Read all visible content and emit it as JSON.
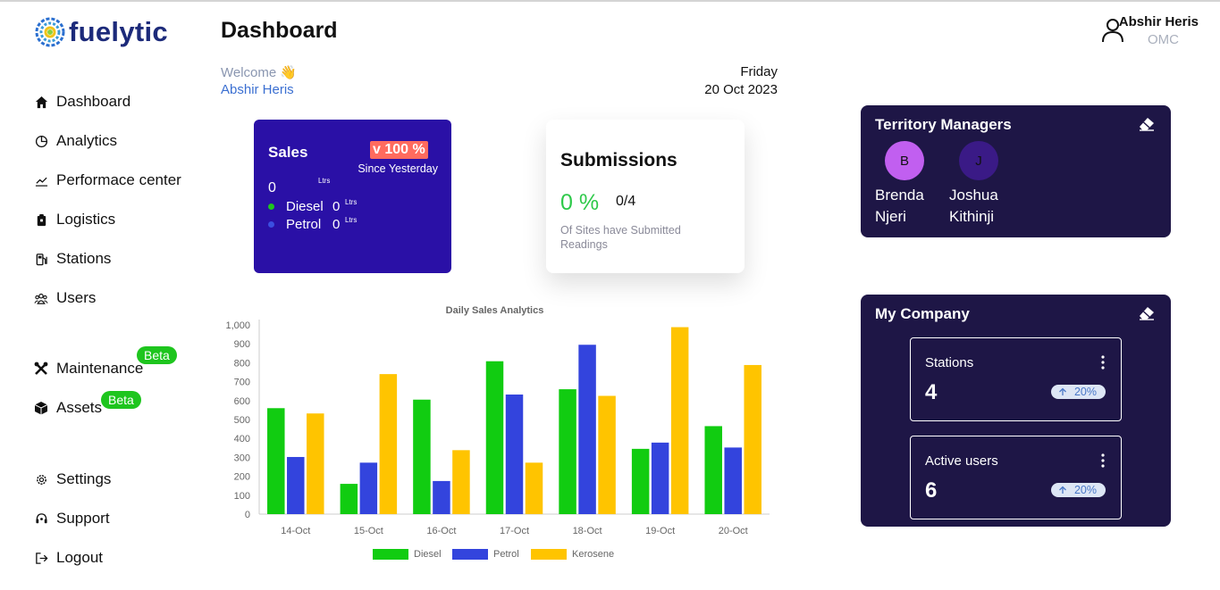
{
  "brand": {
    "name": "fuelytic"
  },
  "sidebar": {
    "items": [
      {
        "label": "Dashboard",
        "icon": "home-icon"
      },
      {
        "label": "Analytics",
        "icon": "pie-chart-icon"
      },
      {
        "label": "Performace center",
        "icon": "trend-line-icon"
      },
      {
        "label": "Logistics",
        "icon": "clipboard-icon"
      },
      {
        "label": "Stations",
        "icon": "fuel-pump-icon"
      },
      {
        "label": "Users",
        "icon": "users-icon"
      },
      {
        "label": "Maintenance",
        "icon": "tools-icon",
        "badge": "Beta"
      },
      {
        "label": "Assets",
        "icon": "box-icon",
        "badge": "Beta"
      },
      {
        "label": "Settings",
        "icon": "gear-icon"
      },
      {
        "label": "Support",
        "icon": "headset-icon"
      },
      {
        "label": "Logout",
        "icon": "logout-icon"
      }
    ]
  },
  "header": {
    "title": "Dashboard",
    "welcome": "Welcome 👋",
    "user_first": "Abshir Heris",
    "day": "Friday",
    "date": "20 Oct 2023"
  },
  "user": {
    "name": "Abshir Heris",
    "role": "OMC"
  },
  "sales": {
    "title": "Sales",
    "badge": "v 100 %",
    "since": "Since Yesterday",
    "total": "0",
    "unit": "Ltrs",
    "rows": [
      {
        "label": "Diesel",
        "value": "0",
        "unit": "Ltrs",
        "color": "#1ec51e"
      },
      {
        "label": "Petrol",
        "value": "0",
        "unit": "Ltrs",
        "color": "#3b4fe0"
      }
    ]
  },
  "submissions": {
    "title": "Submissions",
    "percent": "0 %",
    "count": "0/4",
    "description": "Of Sites have Submitted Readings"
  },
  "chart_data": {
    "type": "bar",
    "title": "Daily Sales Analytics",
    "xlabel": "",
    "ylabel": "",
    "ylim": [
      0,
      1000
    ],
    "yticks": [
      0,
      100,
      200,
      300,
      400,
      500,
      600,
      700,
      800,
      900,
      1000
    ],
    "ytick_labels": [
      "0",
      "100",
      "200",
      "300",
      "400",
      "500",
      "600",
      "700",
      "800",
      "900",
      "1,000"
    ],
    "categories": [
      "14-Oct",
      "15-Oct",
      "16-Oct",
      "17-Oct",
      "18-Oct",
      "19-Oct",
      "20-Oct"
    ],
    "legend_position": "bottom",
    "grid": false,
    "series": [
      {
        "name": "Diesel",
        "color": "#11cc11",
        "values": [
          560,
          160,
          605,
          808,
          660,
          345,
          465
        ]
      },
      {
        "name": "Petrol",
        "color": "#3344dd",
        "values": [
          302,
          272,
          175,
          632,
          895,
          378,
          352
        ]
      },
      {
        "name": "Kerosene",
        "color": "#ffc400",
        "values": [
          532,
          740,
          338,
          272,
          625,
          988,
          788
        ]
      }
    ]
  },
  "territory": {
    "title": "Territory Managers",
    "managers": [
      {
        "initial": "B",
        "first": "Brenda",
        "last": "Njeri",
        "color": "#c15ff0"
      },
      {
        "initial": "J",
        "first": "Joshua",
        "last": "Kithinji",
        "color": "#3a1a86"
      }
    ]
  },
  "company": {
    "title": "My Company",
    "stats": [
      {
        "label": "Stations",
        "value": "4",
        "trend": "20%"
      },
      {
        "label": "Active users",
        "value": "6",
        "trend": "20%"
      }
    ]
  }
}
